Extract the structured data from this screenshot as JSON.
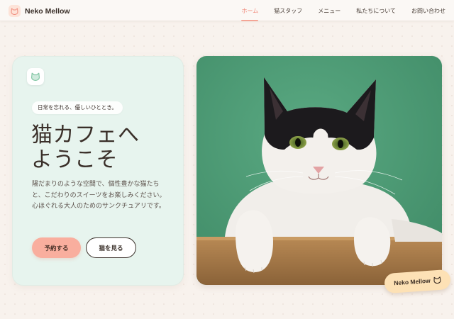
{
  "brand": {
    "name": "Neko Mellow",
    "logo_icon": "cat-face-icon"
  },
  "nav": {
    "items": [
      {
        "label": "ホーム",
        "active": true
      },
      {
        "label": "猫スタッフ",
        "active": false
      },
      {
        "label": "メニュー",
        "active": false
      },
      {
        "label": "私たちについて",
        "active": false
      },
      {
        "label": "お問い合わせ",
        "active": false
      }
    ]
  },
  "hero": {
    "icon": "cat-face-icon",
    "tagline": "日常を忘れる、優しいひととき。",
    "title_line1": "猫カフェへ",
    "title_line2": "ようこそ",
    "description": "陽だまりのような空間で、個性豊かな猫たちと、こだわりのスイーツをお楽しみください。心ほぐれる大人のためのサンクチュアリです。",
    "primary_button": "予約する",
    "secondary_button": "猫を見る"
  },
  "photo": {
    "subject": "black-and-white-cat-photo"
  },
  "badge": {
    "label": "Neko Mellow",
    "icon": "cat-face-icon"
  },
  "colors": {
    "background": "#f8f2ed",
    "card": "#e7f4ee",
    "accent": "#f9ae9e",
    "nav_active": "#f08c7d",
    "badge": "#fde1b5",
    "photo_backdrop": "#4f9f78"
  }
}
